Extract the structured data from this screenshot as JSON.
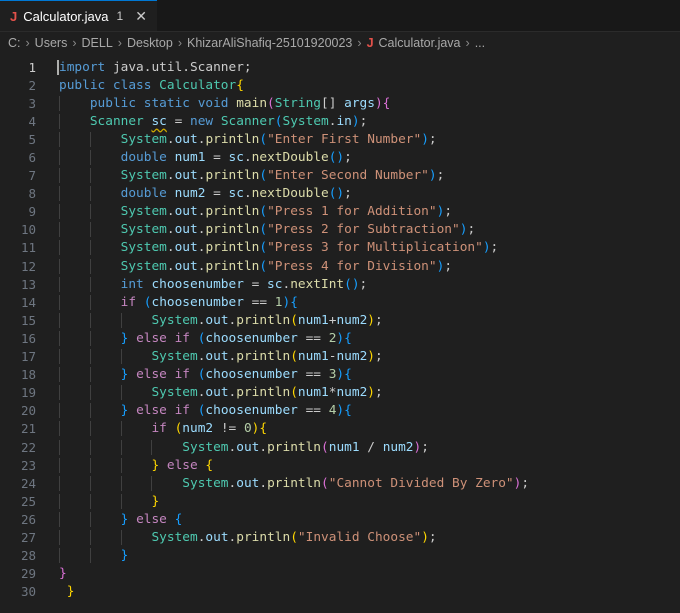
{
  "tab": {
    "icon_label": "J",
    "filename": "Calculator.java",
    "badge": "1"
  },
  "breadcrumb": {
    "parts": [
      "C:",
      "Users",
      "DELL",
      "Desktop",
      "KhizarAliShafiq-25101920023"
    ],
    "java_icon": "J",
    "file": "Calculator.java",
    "tail": "..."
  },
  "colors": {
    "background": "#1f1f1f",
    "keyword": "#569cd6",
    "string": "#ce9178",
    "type": "#4ec9b0",
    "function": "#dcdcaa"
  },
  "code_lines": [
    {
      "n": "1",
      "indent": 0,
      "tokens": [
        [
          "kw",
          "import"
        ],
        [
          "pl",
          " java.util.Scanner;"
        ]
      ]
    },
    {
      "n": "2",
      "indent": 0,
      "tokens": [
        [
          "kw",
          "public class "
        ],
        [
          "ty",
          "Calculator"
        ],
        [
          "b1",
          "{"
        ]
      ]
    },
    {
      "n": "3",
      "indent": 1,
      "tokens": [
        [
          "kw",
          "public static void "
        ],
        [
          "fn",
          "main"
        ],
        [
          "b2",
          "("
        ],
        [
          "ty",
          "String"
        ],
        [
          "pl",
          "[] "
        ],
        [
          "vr",
          "args"
        ],
        [
          "b2",
          ")"
        ],
        [
          "b2",
          "{"
        ]
      ]
    },
    {
      "n": "4",
      "indent": 1,
      "tokens": [
        [
          "ty",
          "Scanner "
        ],
        [
          "sq",
          "sc"
        ],
        [
          "pl",
          " = "
        ],
        [
          "kw",
          "new "
        ],
        [
          "ty",
          "Scanner"
        ],
        [
          "b3",
          "("
        ],
        [
          "ty",
          "System"
        ],
        [
          "pl",
          "."
        ],
        [
          "vr",
          "in"
        ],
        [
          "b3",
          ")"
        ],
        [
          "pl",
          ";"
        ]
      ]
    },
    {
      "n": "5",
      "indent": 2,
      "tokens": [
        [
          "ty",
          "System"
        ],
        [
          "pl",
          "."
        ],
        [
          "vr",
          "out"
        ],
        [
          "pl",
          "."
        ],
        [
          "fn",
          "println"
        ],
        [
          "b3",
          "("
        ],
        [
          "st",
          "\"Enter First Number\""
        ],
        [
          "b3",
          ")"
        ],
        [
          "pl",
          ";"
        ]
      ]
    },
    {
      "n": "6",
      "indent": 2,
      "tokens": [
        [
          "kw",
          "double "
        ],
        [
          "vr",
          "num1"
        ],
        [
          "pl",
          " = "
        ],
        [
          "vr",
          "sc"
        ],
        [
          "pl",
          "."
        ],
        [
          "fn",
          "nextDouble"
        ],
        [
          "b3",
          "()"
        ],
        [
          "pl",
          ";"
        ]
      ]
    },
    {
      "n": "7",
      "indent": 2,
      "tokens": [
        [
          "ty",
          "System"
        ],
        [
          "pl",
          "."
        ],
        [
          "vr",
          "out"
        ],
        [
          "pl",
          "."
        ],
        [
          "fn",
          "println"
        ],
        [
          "b3",
          "("
        ],
        [
          "st",
          "\"Enter Second Number\""
        ],
        [
          "b3",
          ")"
        ],
        [
          "pl",
          ";"
        ]
      ]
    },
    {
      "n": "8",
      "indent": 2,
      "tokens": [
        [
          "kw",
          "double "
        ],
        [
          "vr",
          "num2"
        ],
        [
          "pl",
          " = "
        ],
        [
          "vr",
          "sc"
        ],
        [
          "pl",
          "."
        ],
        [
          "fn",
          "nextDouble"
        ],
        [
          "b3",
          "()"
        ],
        [
          "pl",
          ";"
        ]
      ]
    },
    {
      "n": "9",
      "indent": 2,
      "tokens": [
        [
          "ty",
          "System"
        ],
        [
          "pl",
          "."
        ],
        [
          "vr",
          "out"
        ],
        [
          "pl",
          "."
        ],
        [
          "fn",
          "println"
        ],
        [
          "b3",
          "("
        ],
        [
          "st",
          "\"Press 1 for Addition\""
        ],
        [
          "b3",
          ")"
        ],
        [
          "pl",
          ";"
        ]
      ]
    },
    {
      "n": "10",
      "indent": 2,
      "tokens": [
        [
          "ty",
          "System"
        ],
        [
          "pl",
          "."
        ],
        [
          "vr",
          "out"
        ],
        [
          "pl",
          "."
        ],
        [
          "fn",
          "println"
        ],
        [
          "b3",
          "("
        ],
        [
          "st",
          "\"Press 2 for Subtraction\""
        ],
        [
          "b3",
          ")"
        ],
        [
          "pl",
          ";"
        ]
      ]
    },
    {
      "n": "11",
      "indent": 2,
      "tokens": [
        [
          "ty",
          "System"
        ],
        [
          "pl",
          "."
        ],
        [
          "vr",
          "out"
        ],
        [
          "pl",
          "."
        ],
        [
          "fn",
          "println"
        ],
        [
          "b3",
          "("
        ],
        [
          "st",
          "\"Press 3 for Multiplication\""
        ],
        [
          "b3",
          ")"
        ],
        [
          "pl",
          ";"
        ]
      ]
    },
    {
      "n": "12",
      "indent": 2,
      "tokens": [
        [
          "ty",
          "System"
        ],
        [
          "pl",
          "."
        ],
        [
          "vr",
          "out"
        ],
        [
          "pl",
          "."
        ],
        [
          "fn",
          "println"
        ],
        [
          "b3",
          "("
        ],
        [
          "st",
          "\"Press 4 for Division\""
        ],
        [
          "b3",
          ")"
        ],
        [
          "pl",
          ";"
        ]
      ]
    },
    {
      "n": "13",
      "indent": 2,
      "tokens": [
        [
          "kw",
          "int "
        ],
        [
          "vr",
          "choosenumber"
        ],
        [
          "pl",
          " = "
        ],
        [
          "vr",
          "sc"
        ],
        [
          "pl",
          "."
        ],
        [
          "fn",
          "nextInt"
        ],
        [
          "b3",
          "()"
        ],
        [
          "pl",
          ";"
        ]
      ]
    },
    {
      "n": "14",
      "indent": 2,
      "tokens": [
        [
          "ctl",
          "if "
        ],
        [
          "b3",
          "("
        ],
        [
          "vr",
          "choosenumber"
        ],
        [
          "pl",
          " == "
        ],
        [
          "nm",
          "1"
        ],
        [
          "b3",
          ")"
        ],
        [
          "b3",
          "{"
        ]
      ]
    },
    {
      "n": "15",
      "indent": 3,
      "tokens": [
        [
          "ty",
          "System"
        ],
        [
          "pl",
          "."
        ],
        [
          "vr",
          "out"
        ],
        [
          "pl",
          "."
        ],
        [
          "fn",
          "println"
        ],
        [
          "b1",
          "("
        ],
        [
          "vr",
          "num1"
        ],
        [
          "pl",
          "+"
        ],
        [
          "vr",
          "num2"
        ],
        [
          "b1",
          ")"
        ],
        [
          "pl",
          ";"
        ]
      ]
    },
    {
      "n": "16",
      "indent": 2,
      "tokens": [
        [
          "b3",
          "} "
        ],
        [
          "ctl",
          "else if "
        ],
        [
          "b3",
          "("
        ],
        [
          "vr",
          "choosenumber"
        ],
        [
          "pl",
          " == "
        ],
        [
          "nm",
          "2"
        ],
        [
          "b3",
          ")"
        ],
        [
          "b3",
          "{"
        ]
      ]
    },
    {
      "n": "17",
      "indent": 3,
      "tokens": [
        [
          "ty",
          "System"
        ],
        [
          "pl",
          "."
        ],
        [
          "vr",
          "out"
        ],
        [
          "pl",
          "."
        ],
        [
          "fn",
          "println"
        ],
        [
          "b1",
          "("
        ],
        [
          "vr",
          "num1"
        ],
        [
          "pl",
          "-"
        ],
        [
          "vr",
          "num2"
        ],
        [
          "b1",
          ")"
        ],
        [
          "pl",
          ";"
        ]
      ]
    },
    {
      "n": "18",
      "indent": 2,
      "tokens": [
        [
          "b3",
          "} "
        ],
        [
          "ctl",
          "else if "
        ],
        [
          "b3",
          "("
        ],
        [
          "vr",
          "choosenumber"
        ],
        [
          "pl",
          " == "
        ],
        [
          "nm",
          "3"
        ],
        [
          "b3",
          ")"
        ],
        [
          "b3",
          "{"
        ]
      ]
    },
    {
      "n": "19",
      "indent": 3,
      "tokens": [
        [
          "ty",
          "System"
        ],
        [
          "pl",
          "."
        ],
        [
          "vr",
          "out"
        ],
        [
          "pl",
          "."
        ],
        [
          "fn",
          "println"
        ],
        [
          "b1",
          "("
        ],
        [
          "vr",
          "num1"
        ],
        [
          "pl",
          "*"
        ],
        [
          "vr",
          "num2"
        ],
        [
          "b1",
          ")"
        ],
        [
          "pl",
          ";"
        ]
      ]
    },
    {
      "n": "20",
      "indent": 2,
      "tokens": [
        [
          "b3",
          "} "
        ],
        [
          "ctl",
          "else if "
        ],
        [
          "b3",
          "("
        ],
        [
          "vr",
          "choosenumber"
        ],
        [
          "pl",
          " == "
        ],
        [
          "nm",
          "4"
        ],
        [
          "b3",
          ")"
        ],
        [
          "b3",
          "{"
        ]
      ]
    },
    {
      "n": "21",
      "indent": 3,
      "tokens": [
        [
          "ctl",
          "if "
        ],
        [
          "b1",
          "("
        ],
        [
          "vr",
          "num2"
        ],
        [
          "pl",
          " != "
        ],
        [
          "nm",
          "0"
        ],
        [
          "b1",
          ")"
        ],
        [
          "b1",
          "{"
        ]
      ]
    },
    {
      "n": "22",
      "indent": 4,
      "tokens": [
        [
          "ty",
          "System"
        ],
        [
          "pl",
          "."
        ],
        [
          "vr",
          "out"
        ],
        [
          "pl",
          "."
        ],
        [
          "fn",
          "println"
        ],
        [
          "b2",
          "("
        ],
        [
          "vr",
          "num1"
        ],
        [
          "pl",
          " / "
        ],
        [
          "vr",
          "num2"
        ],
        [
          "b2",
          ")"
        ],
        [
          "pl",
          ";"
        ]
      ]
    },
    {
      "n": "23",
      "indent": 3,
      "tokens": [
        [
          "b1",
          "} "
        ],
        [
          "ctl",
          "else "
        ],
        [
          "b1",
          "{"
        ]
      ]
    },
    {
      "n": "24",
      "indent": 4,
      "tokens": [
        [
          "ty",
          "System"
        ],
        [
          "pl",
          "."
        ],
        [
          "vr",
          "out"
        ],
        [
          "pl",
          "."
        ],
        [
          "fn",
          "println"
        ],
        [
          "b2",
          "("
        ],
        [
          "st",
          "\"Cannot Divided By Zero\""
        ],
        [
          "b2",
          ")"
        ],
        [
          "pl",
          ";"
        ]
      ]
    },
    {
      "n": "25",
      "indent": 3,
      "tokens": [
        [
          "b1",
          "}"
        ]
      ]
    },
    {
      "n": "26",
      "indent": 2,
      "tokens": [
        [
          "b3",
          "} "
        ],
        [
          "ctl",
          "else "
        ],
        [
          "b3",
          "{"
        ]
      ]
    },
    {
      "n": "27",
      "indent": 3,
      "tokens": [
        [
          "ty",
          "System"
        ],
        [
          "pl",
          "."
        ],
        [
          "vr",
          "out"
        ],
        [
          "pl",
          "."
        ],
        [
          "fn",
          "println"
        ],
        [
          "b1",
          "("
        ],
        [
          "st",
          "\"Invalid Choose\""
        ],
        [
          "b1",
          ")"
        ],
        [
          "pl",
          ";"
        ]
      ]
    },
    {
      "n": "28",
      "indent": 2,
      "tokens": [
        [
          "b3",
          "}"
        ]
      ]
    },
    {
      "n": "29",
      "indent": 0,
      "tokens": [
        [
          "b2",
          "}"
        ]
      ]
    },
    {
      "n": "30",
      "indent": 0,
      "tokens": [
        [
          "pl",
          " "
        ],
        [
          "b1",
          "}"
        ]
      ]
    }
  ]
}
